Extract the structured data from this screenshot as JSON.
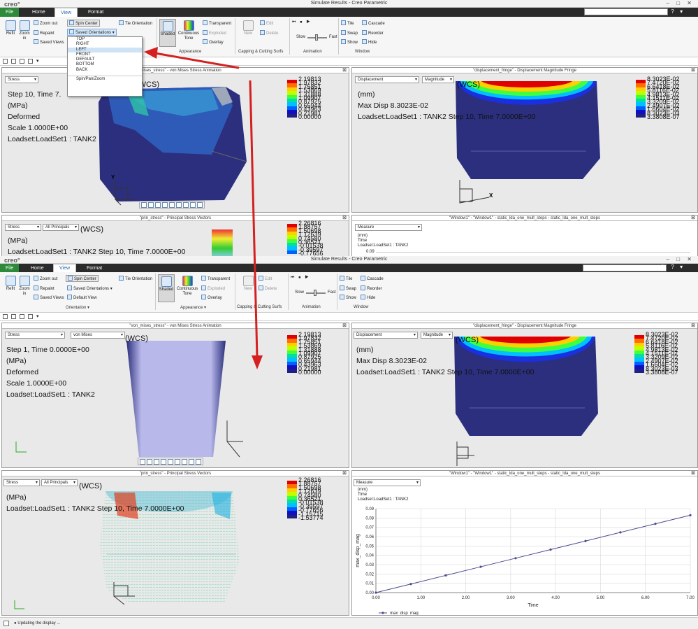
{
  "window_title": "Simulate Results - Creo Parametric",
  "logo": "creo°",
  "tabs": [
    "File",
    "Home",
    "View",
    "Format"
  ],
  "ribbon": {
    "refit": "Refit",
    "zoom_in": "Zoom in",
    "zoom_out": "Zoom out",
    "repaint": "Repaint",
    "saved_views": "Saved Views",
    "spin_center": "Spin Center",
    "saved_orientations": "Saved Orientations",
    "default_view": "Default View",
    "tie_orientation": "Tie Orientation",
    "orientation_group": "Orientation",
    "shaded": "Shaded",
    "continuous_tone": "Continuous Tone",
    "transparent": "Transparent",
    "exploded": "Exploded",
    "overlay": "Overlay",
    "appearance_group": "Appearance",
    "new": "New",
    "edit": "Edit",
    "delete": "Delete",
    "capping_group": "Capping & Cutting Surfs",
    "slow": "Slow",
    "fast": "Fast",
    "animation_group": "Animation",
    "tile": "Tile",
    "cascade": "Cascade",
    "swap": "Swap",
    "reorder": "Reorder",
    "show": "Show",
    "hide": "Hide",
    "window_group": "Window"
  },
  "orientations_menu": [
    "TOP",
    "RIGHT",
    "LEFT",
    "FRONT",
    "DEFAULT",
    "BOTTOM",
    "BACK",
    "Spin/Pan/Zoom"
  ],
  "stress_panel": {
    "title": "\"von_mises_stress\" - von Mises Stress Animation",
    "sel1": "Stress",
    "sel2": "von Mises",
    "wcs": "(WCS)",
    "top": {
      "step": "Step  10, Time  7.",
      "units": "(MPa)",
      "deformed": "Deformed",
      "scale": "Scale  1.0000E+00",
      "loadset": "Loadset:LoadSet1 :  TANK2"
    },
    "bottom": {
      "step": "Step  1, Time  0.0000E+00",
      "units": "(MPa)",
      "deformed": "Deformed",
      "scale": "Scale  1.0000E+00",
      "loadset": "Loadset:LoadSet1 :  TANK2"
    },
    "legend": [
      "2.19813",
      "1.97832",
      "1.75851",
      "1.53869",
      "1.31888",
      "1.09907",
      "0.87925",
      "0.65944",
      "0.43963",
      "0.21981",
      "0.00000"
    ]
  },
  "disp_panel": {
    "title": "\"displacement_fringe\" - Displacement Magnitude Fringe",
    "sel1": "Displacement",
    "sel2": "Magnitude",
    "wcs": "(WCS)",
    "units": "(mm)",
    "maxdisp": "Max Disp  8.3023E-02",
    "loadset": "Loadset:LoadSet1 :  TANK2 Step 10, Time 7.0000E+00",
    "legend": [
      "8.3023E-02",
      "7.4720E-02",
      "6.6418E-02",
      "5.8116E-02",
      "4.9813E-02",
      "4.1511E-02",
      "3.3209E-02",
      "2.4907E-02",
      "1.6604E-02",
      "8.3023E-03",
      "3.3808E-07"
    ]
  },
  "prin_panel": {
    "title": "\"prin_stress\" - Principal Stress Vectors",
    "sel1": "Stress",
    "sel2": "All Principals",
    "wcs": "(WCS)",
    "units": "(MPa)",
    "loadset": "Loadset:LoadSet1 :  TANK2 Step 10, Time  7.0000E+00",
    "legend": [
      "2.26816",
      "1.88757",
      "1.50698",
      "1.12639",
      "0.74580",
      "0.36521",
      "-0.01538",
      "-0.39597",
      "-0.77656",
      "-1.15715",
      "-1.53774"
    ]
  },
  "graph_panel": {
    "title": "\"Window1\" - \"Window1\" - static_lda_one_mult_steps - static_lda_one_mult_steps",
    "sel1": "Measure",
    "label1": "(mm)",
    "label2": "Time",
    "label3": "Loadset:LoadSet1 :  TANK2",
    "top_tick": "0.09"
  },
  "chart_data": {
    "type": "line",
    "title": "",
    "xlabel": "Time",
    "ylabel": "max_disp_mag",
    "xlim": [
      0,
      7
    ],
    "ylim": [
      0,
      0.09
    ],
    "xticks": [
      "0.00",
      "1.00",
      "2.00",
      "3.00",
      "4.00",
      "5.00",
      "6.00",
      "7.00"
    ],
    "yticks": [
      "0.00",
      "0.01",
      "0.02",
      "0.03",
      "0.04",
      "0.05",
      "0.06",
      "0.07",
      "0.08",
      "0.09"
    ],
    "grid": true,
    "legend": "bottom-left",
    "series": [
      {
        "name": "max_disp_mag",
        "x": [
          0,
          0.778,
          1.556,
          2.333,
          3.111,
          3.889,
          4.667,
          5.444,
          6.222,
          7.0
        ],
        "y": [
          0,
          0.0092,
          0.0185,
          0.0277,
          0.0369,
          0.0461,
          0.0553,
          0.0646,
          0.0738,
          0.083
        ]
      }
    ]
  },
  "status_text": "Updating the display ...",
  "colors": {
    "file_tab": "#2c8a3a",
    "arrow": "#d42020",
    "model": "#2c2f7d",
    "series": "#4b4b8f"
  }
}
